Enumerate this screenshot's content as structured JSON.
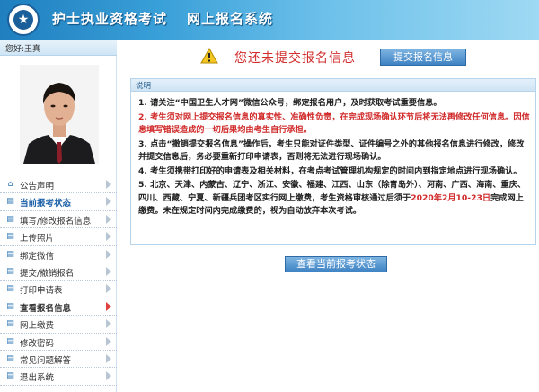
{
  "header": {
    "site_title": "护士执业资格考试",
    "system_title": "网上报名系统"
  },
  "sidebar": {
    "greeting": "您好:王真",
    "menu": [
      {
        "label": "公告声明",
        "icon": "house-icon"
      },
      {
        "label": "当前报考状态",
        "icon": "doc-icon",
        "active": true
      },
      {
        "label": "填写/修改报名信息",
        "icon": "doc-icon"
      },
      {
        "label": "上传照片",
        "icon": "doc-icon"
      },
      {
        "label": "绑定微信",
        "icon": "doc-icon"
      },
      {
        "label": "提交/撤销报名",
        "icon": "doc-icon"
      },
      {
        "label": "打印申请表",
        "icon": "doc-icon"
      },
      {
        "label": "查看报名信息",
        "icon": "doc-icon",
        "active_arrow": true
      },
      {
        "label": "网上缴费",
        "icon": "doc-icon"
      },
      {
        "label": "修改密码",
        "icon": "doc-icon"
      },
      {
        "label": "常见问题解答",
        "icon": "doc-icon"
      },
      {
        "label": "退出系统",
        "icon": "doc-icon"
      }
    ]
  },
  "main": {
    "notice": "您还未提交报名信息",
    "submit_button": "提交报名信息",
    "panel_title": "说明",
    "items": {
      "i1": "1. 请关注“中国卫生人才网”微信公众号，绑定报名用户，及时获取考试重要信息。",
      "i2": "2. 考生须对网上提交报名信息的真实性、准确性负责，在完成现场确认环节后将无法再修改任何信息。因信息填写错误造成的一切后果均由考生自行承担。",
      "i3": "3. 点击“撤销提交报名信息”操作后，考生只能对证件类型、证件编号之外的其他报名信息进行修改，修改并提交信息后，务必要重新打印申请表，否则将无法进行现场确认。",
      "i4": "4. 考生须携带打印好的申请表及相关材料，在考点考试管理机构规定的时间内到指定地点进行现场确认。",
      "i5a": "5. 北京、天津、内蒙古、辽宁、浙江、安徽、福建、江西、山东（除青岛外）、河南、广西、海南、重庆、四川、西藏、宁夏、新疆兵团考区实行网上缴费，考生资格审核通过后须于",
      "i5date": "2020年2月10-23日",
      "i5b": "完成网上缴费。未在规定时间内完成缴费的，视为自动放弃本次考试。"
    },
    "view_button": "查看当前报考状态"
  },
  "colors": {
    "accent_blue": "#3f83c4",
    "warning_red": "#d12c2c"
  }
}
